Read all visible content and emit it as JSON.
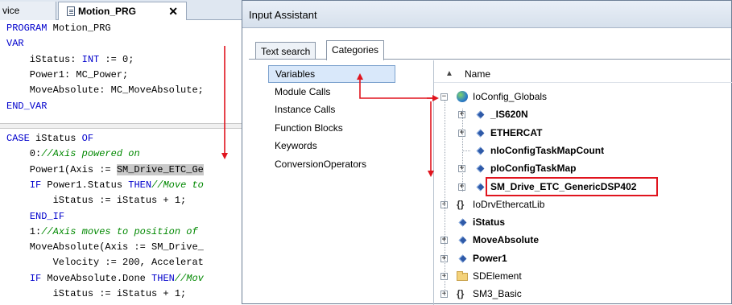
{
  "editor": {
    "tabs": [
      {
        "label": "vice"
      },
      {
        "label": "Motion_PRG",
        "close": "✕"
      }
    ],
    "declaration": [
      [
        {
          "t": "PROGRAM",
          "c": "kw"
        },
        {
          "t": " Motion_PRG"
        }
      ],
      [
        {
          "t": "VAR",
          "c": "kw"
        }
      ],
      [
        {
          "t": "    iStatus: "
        },
        {
          "t": "INT",
          "c": "kw"
        },
        {
          "t": " := 0;"
        }
      ],
      [
        {
          "t": "    Power1: MC_Power;"
        }
      ],
      [
        {
          "t": "    MoveAbsolute: MC_MoveAbsolute;"
        }
      ],
      [
        {
          "t": "END_VAR",
          "c": "kw"
        }
      ]
    ],
    "implementation": [
      [
        {
          "t": "CASE",
          "c": "kw"
        },
        {
          "t": " iStatus "
        },
        {
          "t": "OF",
          "c": "kw"
        }
      ],
      [
        {
          "t": "    0:"
        },
        {
          "t": "//Axis powered on",
          "c": "cm"
        }
      ],
      [
        {
          "t": "    Power1(Axis := "
        },
        {
          "t": "SM_Drive_ETC_Ge",
          "c": "hl"
        }
      ],
      [
        {
          "t": "    "
        },
        {
          "t": "IF",
          "c": "kw"
        },
        {
          "t": " Power1.Status "
        },
        {
          "t": "THEN",
          "c": "kw"
        },
        {
          "t": "//Move to",
          "c": "cm"
        }
      ],
      [
        {
          "t": "        iStatus := iStatus + 1;"
        }
      ],
      [
        {
          "t": "    "
        },
        {
          "t": "END_IF",
          "c": "kw"
        }
      ],
      [
        {
          "t": "    1:"
        },
        {
          "t": "//Axis moves to position of",
          "c": "cm"
        }
      ],
      [
        {
          "t": "    MoveAbsolute(Axis := SM_Drive_"
        }
      ],
      [
        {
          "t": "        Velocity := 200, Accelerat"
        }
      ],
      [
        {
          "t": "    "
        },
        {
          "t": "IF",
          "c": "kw"
        },
        {
          "t": " MoveAbsolute.Done "
        },
        {
          "t": "THEN",
          "c": "kw"
        },
        {
          "t": "//Mov",
          "c": "cm"
        }
      ],
      [
        {
          "t": "        iStatus := iStatus + 1;"
        }
      ]
    ]
  },
  "dialog": {
    "title": "Input Assistant",
    "tabs": [
      "Text search",
      "Categories"
    ],
    "categories": [
      "Variables",
      "Module Calls",
      "Instance Calls",
      "Function Blocks",
      "Keywords",
      "ConversionOperators"
    ],
    "tree": {
      "column_header": "Name",
      "sort_glyph": "▲",
      "rows": [
        {
          "label": "IoConfig_Globals",
          "icon": "globe-icon",
          "exp": "−",
          "bold": false,
          "indent": 0
        },
        {
          "label": "_IS620N",
          "icon": "variable-icon",
          "exp": "+",
          "bold": true,
          "indent": 1
        },
        {
          "label": "ETHERCAT",
          "icon": "variable-icon",
          "exp": "+",
          "bold": true,
          "indent": 1
        },
        {
          "label": "nIoConfigTaskMapCount",
          "icon": "variable-icon",
          "exp": "",
          "bold": true,
          "indent": 1
        },
        {
          "label": "pIoConfigTaskMap",
          "icon": "variable-icon",
          "exp": "+",
          "bold": true,
          "indent": 1
        },
        {
          "label": "SM_Drive_ETC_GenericDSP402",
          "icon": "variable-icon",
          "exp": "+",
          "bold": true,
          "indent": 1
        },
        {
          "label": "IoDrvEthercatLib",
          "icon": "library-icon",
          "exp": "+",
          "bold": false,
          "indent": 0
        },
        {
          "label": "iStatus",
          "icon": "variable-icon",
          "exp": "",
          "bold": true,
          "indent": 0
        },
        {
          "label": "MoveAbsolute",
          "icon": "variable-icon",
          "exp": "+",
          "bold": true,
          "indent": 0
        },
        {
          "label": "Power1",
          "icon": "variable-icon",
          "exp": "+",
          "bold": true,
          "indent": 0
        },
        {
          "label": "SDElement",
          "icon": "folder-icon",
          "exp": "+",
          "bold": false,
          "indent": 0
        },
        {
          "label": "SM3_Basic",
          "icon": "library-icon",
          "exp": "+",
          "bold": false,
          "indent": 0
        }
      ]
    }
  },
  "colors": {
    "keyword": "#0000cc",
    "comment": "#008800",
    "annotation_red": "#e0141e",
    "selection_bg": "#d9e8fa"
  }
}
